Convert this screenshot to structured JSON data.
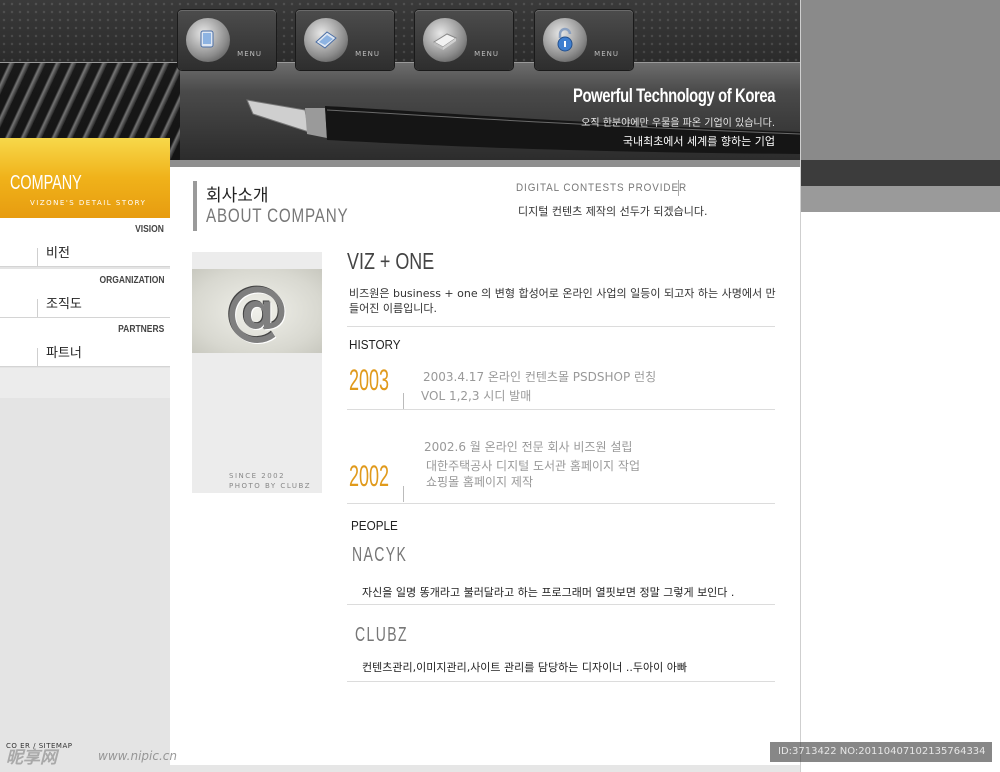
{
  "header": {
    "menu_buttons": [
      {
        "label": "MENU",
        "icon": "monitor-icon"
      },
      {
        "label": "MENU",
        "icon": "tablet-icon"
      },
      {
        "label": "MENU",
        "icon": "scanner-icon"
      },
      {
        "label": "MENU",
        "icon": "lock-icon"
      }
    ],
    "tagline_title": "Powerful Technology of Korea",
    "tagline_line1": "오직 한분야에만 우물을 파온 기업이 있습니다.",
    "tagline_line2": "국내최초에서 세계를 향하는 기업"
  },
  "sidebar": {
    "banner_title": "COMPANY",
    "banner_subtitle": "VIZONE'S DETAIL STORY",
    "items": [
      {
        "en": "VISION",
        "ko": "비전"
      },
      {
        "en": "ORGANIZATION",
        "ko": "조직도"
      },
      {
        "en": "PARTNERS",
        "ko": "파트너"
      }
    ],
    "footer_links": "CO    ER / SITEMAP"
  },
  "page": {
    "title_ko": "회사소개",
    "title_en": "ABOUT COMPANY",
    "provider_en": "DIGITAL CONTESTS PROVIDER",
    "provider_ko": "디지털 컨텐츠 제작의 선두가 되겠습니다.",
    "photo_caption_1": "SINCE 2002",
    "photo_caption_2": "PHOTO BY CLUBZ"
  },
  "content": {
    "heading": "VIZ + ONE",
    "intro": "비즈원은 business +  one 의 변형 합성어로 온라인 사업의 일등이 되고자 하는 사명에서 만들어진 이름입니다.",
    "history_label": "HISTORY",
    "history": [
      {
        "year": "2003",
        "lines": [
          "2003.4.17 온라인 컨텐츠몰 PSDSHOP 런칭",
          "VOL 1,2,3 시디 발매"
        ]
      },
      {
        "year": "2002",
        "lines": [
          "2002.6 월 온라인 전문 회사 비즈원 설립",
          "대한주택공사 디지털 도서관 홈페이지 작업",
          "쇼핑몰 홈페이지 제작"
        ]
      }
    ],
    "people_label": "PEOPLE",
    "people": [
      {
        "name": "NACYK",
        "desc": "자신을 일명 똥개라고 불러달라고 하는 프로그래머 열핏보면 정말 그렇게 보인다 ."
      },
      {
        "name": "CLUBZ",
        "desc": "컨텐츠관리,이미지관리,사이트 관리를 담당하는 디자이너 ..두아이 아빠"
      }
    ]
  },
  "watermark": {
    "logo_text": "昵享网",
    "url": "www.nipic.cn",
    "id_text": "ID:3713422 NO:20110407102135764334"
  },
  "colors": {
    "accent": "#e09a1c",
    "banner": "#f0b21a",
    "header": "#2b2b2b"
  }
}
